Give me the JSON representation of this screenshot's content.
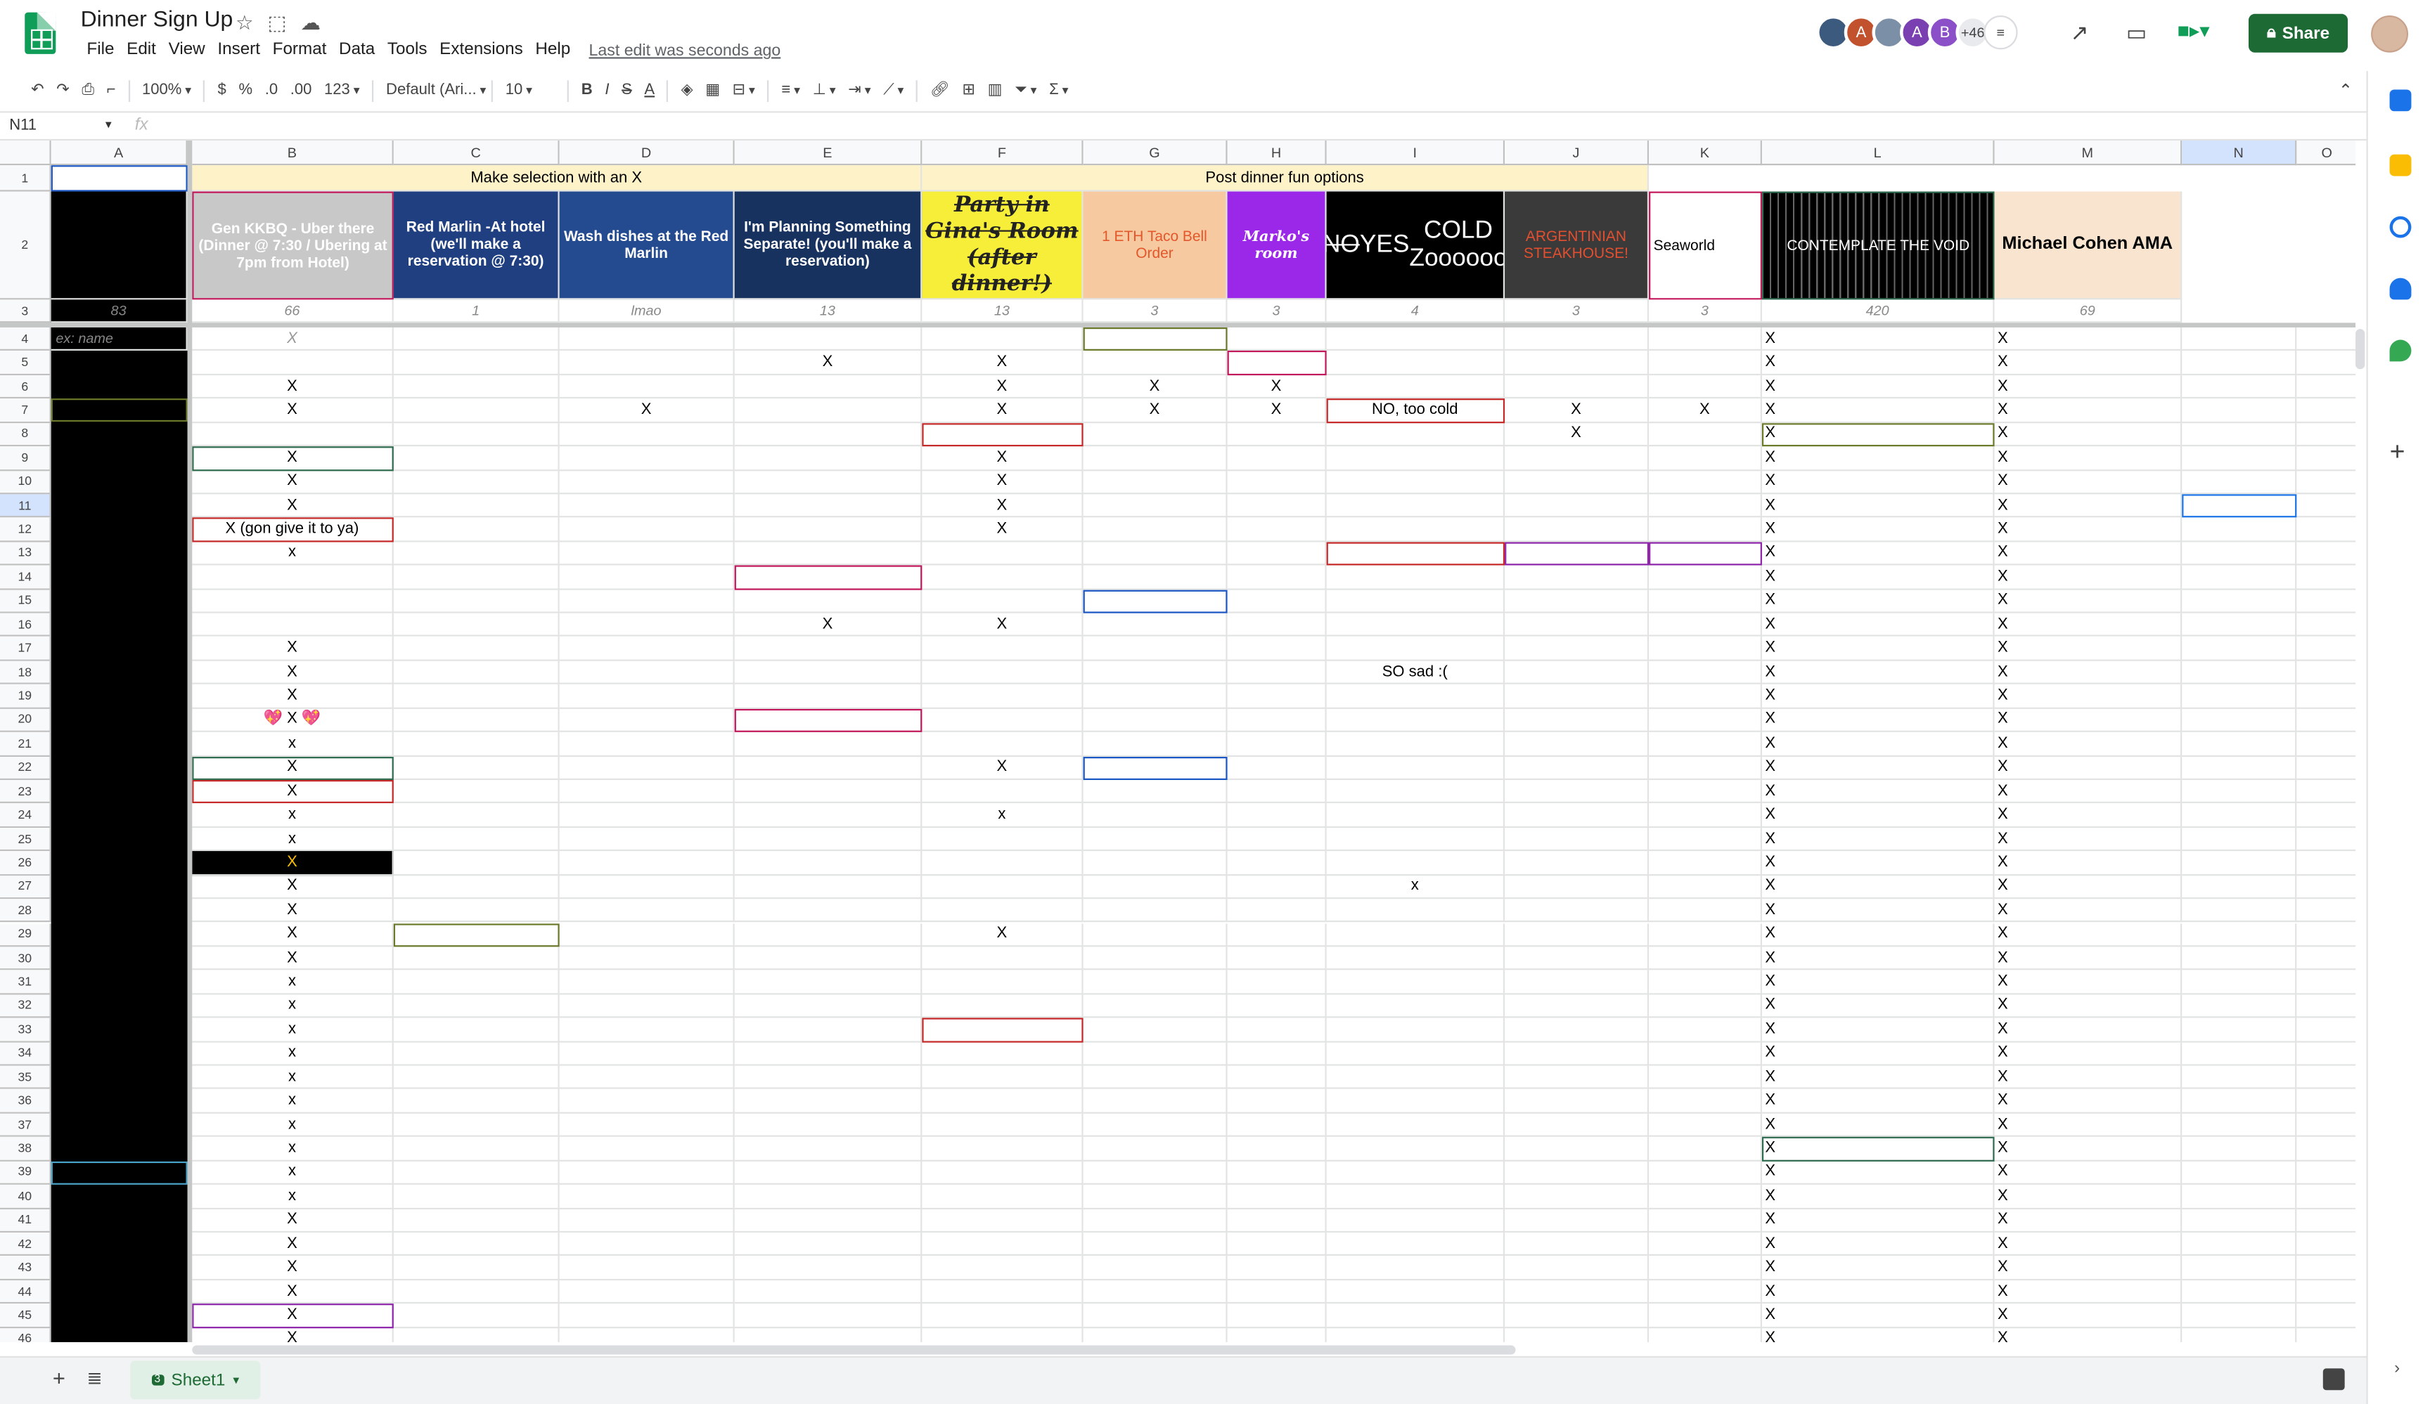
{
  "header": {
    "title": "Dinner Sign Up",
    "last_edit": "Last edit was seconds ago",
    "share_label": "Share",
    "avatars": [
      {
        "letter": "",
        "color": "#3c5a7d"
      },
      {
        "letter": "A",
        "color": "#c2512d"
      },
      {
        "letter": "",
        "color": "#7b8fa6"
      },
      {
        "letter": "A",
        "color": "#7a3fb1"
      },
      {
        "letter": "B",
        "color": "#8b4fc7"
      },
      {
        "letter": "+46",
        "color": "#e8eaed"
      }
    ]
  },
  "menu": [
    "File",
    "Edit",
    "View",
    "Insert",
    "Format",
    "Data",
    "Tools",
    "Extensions",
    "Help"
  ],
  "toolbar": {
    "zoom": "100%",
    "currency": "$",
    "percent": "%",
    "dec_less": ".0",
    "dec_more": ".00",
    "format": "123",
    "font": "Default (Ari...",
    "font_size": "10"
  },
  "formula": {
    "cell_ref": "N11",
    "fx": "fx"
  },
  "columns": [
    "A",
    "B",
    "C",
    "D",
    "E",
    "F",
    "G",
    "H",
    "I",
    "J",
    "K",
    "L",
    "M",
    "N",
    "O"
  ],
  "row1": {
    "left_header": "Make selection with an X",
    "right_header": "Post dinner fun options"
  },
  "options": [
    {
      "col": "B",
      "text": "Gen KKBQ - Uber there (Dinner @ 7:30 / Ubering at 7pm from Hotel)",
      "count": "66"
    },
    {
      "col": "C",
      "text": "Red Marlin -At hotel (we'll make a reservation @ 7:30)",
      "count": "1"
    },
    {
      "col": "D",
      "text": "Wash dishes at the Red Marlin",
      "count": "lmao"
    },
    {
      "col": "E",
      "text": "I'm Planning Something Separate! (you'll make a reservation)",
      "count": "13"
    },
    {
      "col": "F",
      "text": "Party in Gina's Room (after dinner!)",
      "count": "13"
    },
    {
      "col": "G",
      "text": "1 ETH Taco Bell Order",
      "count": "3"
    },
    {
      "col": "H",
      "text": "Marko's room",
      "count": "3"
    },
    {
      "col": "I",
      "text_strike": "NO",
      "text_yes": "YES",
      "text_rest": "COLD Zoooooo",
      "count": "4"
    },
    {
      "col": "J",
      "text": "ARGENTINIAN STEAKHOUSE!",
      "count": "3"
    },
    {
      "col": "K",
      "text": "Seaworld",
      "count": "3"
    },
    {
      "col": "L",
      "text": "CONTEMPLATE THE VOID",
      "count": "420"
    },
    {
      "col": "M",
      "text": "Michael Cohen AMA",
      "count": "69"
    }
  ],
  "a3_count": "83",
  "a4_placeholder": "ex: name",
  "b4_placeholder": "X",
  "entries": {
    "B": {
      "6": "X",
      "7": "X",
      "9": "X",
      "10": "X",
      "11": "X",
      "12": "X (gon give it to ya)",
      "13": "x",
      "17": "X",
      "18": "X",
      "19": "X",
      "20": "💖 X 💖",
      "21": "x",
      "22": "X",
      "23": "X",
      "24": "x",
      "25": "x",
      "26": "X",
      "27": "X",
      "28": "X",
      "29": "X",
      "30": "X",
      "31": "x",
      "32": "x",
      "33": "x",
      "34": "x",
      "35": "x",
      "36": "x",
      "37": "x",
      "38": "x",
      "39": "x",
      "40": "x",
      "41": "X",
      "42": "X",
      "43": "X",
      "44": "X",
      "45": "X",
      "46": "X"
    },
    "D": {
      "7": "X"
    },
    "E": {
      "5": "X",
      "16": "X"
    },
    "F": {
      "5": "X",
      "6": "X",
      "7": "X",
      "9": "X",
      "10": "X",
      "11": "X",
      "12": "X",
      "16": "X",
      "22": "X",
      "24": "x",
      "29": "X"
    },
    "G": {
      "6": "X",
      "7": "X"
    },
    "H": {
      "6": "X",
      "7": "X"
    },
    "I": {
      "7": "NO, too cold",
      "18": "SO sad :(",
      "27": "x"
    },
    "J": {
      "7": "X",
      "8": "X"
    },
    "K": {
      "7": "X"
    },
    "L": {
      "4": "X",
      "5": "X",
      "6": "X",
      "7": "X",
      "8": "X",
      "9": "X",
      "10": "X",
      "11": "X",
      "12": "X",
      "13": "X",
      "14": "X",
      "15": "X",
      "16": "X",
      "17": "X",
      "18": "X",
      "19": "X",
      "20": "X",
      "21": "X",
      "22": "X",
      "23": "X",
      "24": "X",
      "25": "X",
      "26": "X",
      "27": "X",
      "28": "X",
      "29": "X",
      "30": "X",
      "31": "X",
      "32": "X",
      "33": "X",
      "34": "X",
      "35": "X",
      "36": "X",
      "37": "X",
      "38": "X",
      "39": "X",
      "40": "X",
      "41": "X",
      "42": "X",
      "43": "X",
      "44": "X",
      "45": "X",
      "46": "X"
    },
    "M": {
      "4": "X",
      "5": "X",
      "6": "X",
      "7": "X",
      "8": "X",
      "9": "X",
      "10": "X",
      "11": "X",
      "12": "X",
      "13": "X",
      "14": "X",
      "15": "X",
      "16": "X",
      "17": "X",
      "18": "X",
      "19": "X",
      "20": "X",
      "21": "X",
      "22": "X",
      "23": "X",
      "24": "X",
      "25": "X",
      "26": "X",
      "27": "X",
      "28": "X",
      "29": "X",
      "30": "X",
      "31": "X",
      "32": "X",
      "33": "X",
      "34": "X",
      "35": "X",
      "36": "X",
      "37": "X",
      "38": "X",
      "39": "X",
      "40": "X",
      "41": "X",
      "42": "X",
      "43": "X",
      "44": "X",
      "45": "X",
      "46": "X"
    }
  },
  "cursors": [
    {
      "col": "G",
      "row": 4,
      "color": "#6b7a2a"
    },
    {
      "col": "H",
      "row": 5,
      "color": "#c2185b"
    },
    {
      "col": "I",
      "row": 7,
      "color": "#c62828"
    },
    {
      "col": "F",
      "row": 8,
      "color": "#c62828"
    },
    {
      "col": "L",
      "row": 8,
      "color": "#6b7a2a"
    },
    {
      "col": "B",
      "row": 9,
      "color": "#2e6b4f"
    },
    {
      "col": "B",
      "row": 12,
      "color": "#c62828"
    },
    {
      "col": "I",
      "row": 13,
      "color": "#c62828"
    },
    {
      "col": "J",
      "row": 13,
      "color": "#8e24aa"
    },
    {
      "col": "K",
      "row": 13,
      "color": "#8e24aa"
    },
    {
      "col": "E",
      "row": 14,
      "color": "#c2185b"
    },
    {
      "col": "G",
      "row": 15,
      "color": "#1a56c4"
    },
    {
      "col": "E",
      "row": 20,
      "color": "#c2185b"
    },
    {
      "col": "B",
      "row": 22,
      "color": "#2e6b4f"
    },
    {
      "col": "G",
      "row": 22,
      "color": "#1a56c4"
    },
    {
      "col": "B",
      "row": 23,
      "color": "#c62828"
    },
    {
      "col": "C",
      "row": 29,
      "color": "#6b7a2a"
    },
    {
      "col": "F",
      "row": 33,
      "color": "#c62828"
    },
    {
      "col": "L",
      "row": 38,
      "color": "#2e6b4f"
    },
    {
      "col": "B",
      "row": 45,
      "color": "#8e24aa"
    },
    {
      "col": "N",
      "row": 11,
      "color": "#1a73e8"
    }
  ],
  "sheet_tab": {
    "num": "3",
    "label": "Sheet1"
  },
  "icons": [
    "undo-icon",
    "redo-icon",
    "print-icon",
    "paint-format-icon",
    "bold-icon",
    "italic-icon",
    "strikethrough-icon",
    "text-color-icon",
    "fill-color-icon",
    "borders-icon",
    "merge-icon",
    "align-icon",
    "valign-icon",
    "wrap-icon",
    "rotate-icon",
    "link-icon",
    "comment-icon",
    "chart-icon",
    "filter-icon",
    "functions-icon"
  ]
}
